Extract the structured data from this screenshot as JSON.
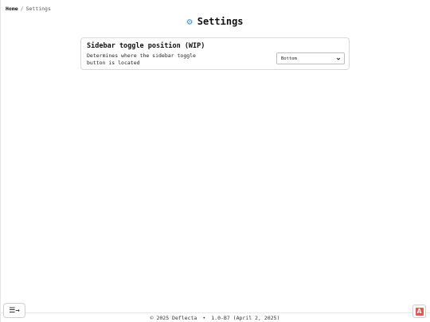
{
  "breadcrumb": {
    "home": "Home",
    "separator": "/",
    "current": "Settings"
  },
  "header": {
    "icon": "gear-icon",
    "icon_glyph": "⚙",
    "title": "Settings"
  },
  "setting": {
    "title": "Sidebar toggle position (WIP)",
    "description": "Determines where the sidebar toggle button is located",
    "selected": "Bottom"
  },
  "footer": {
    "copyright": "© 2025 Deflecta",
    "separator": "•",
    "version": "1.0-B7 (April 2, 2025)"
  },
  "sidebar_toggle": {
    "icon": "menu-arrow-icon",
    "label": "☰→"
  },
  "corner_badge": {
    "icon": "app-badge-icon",
    "letter": "A",
    "color": "#e05a4f"
  },
  "colors": {
    "accent": "#4a8fd0",
    "border": "#d9d9d9"
  }
}
